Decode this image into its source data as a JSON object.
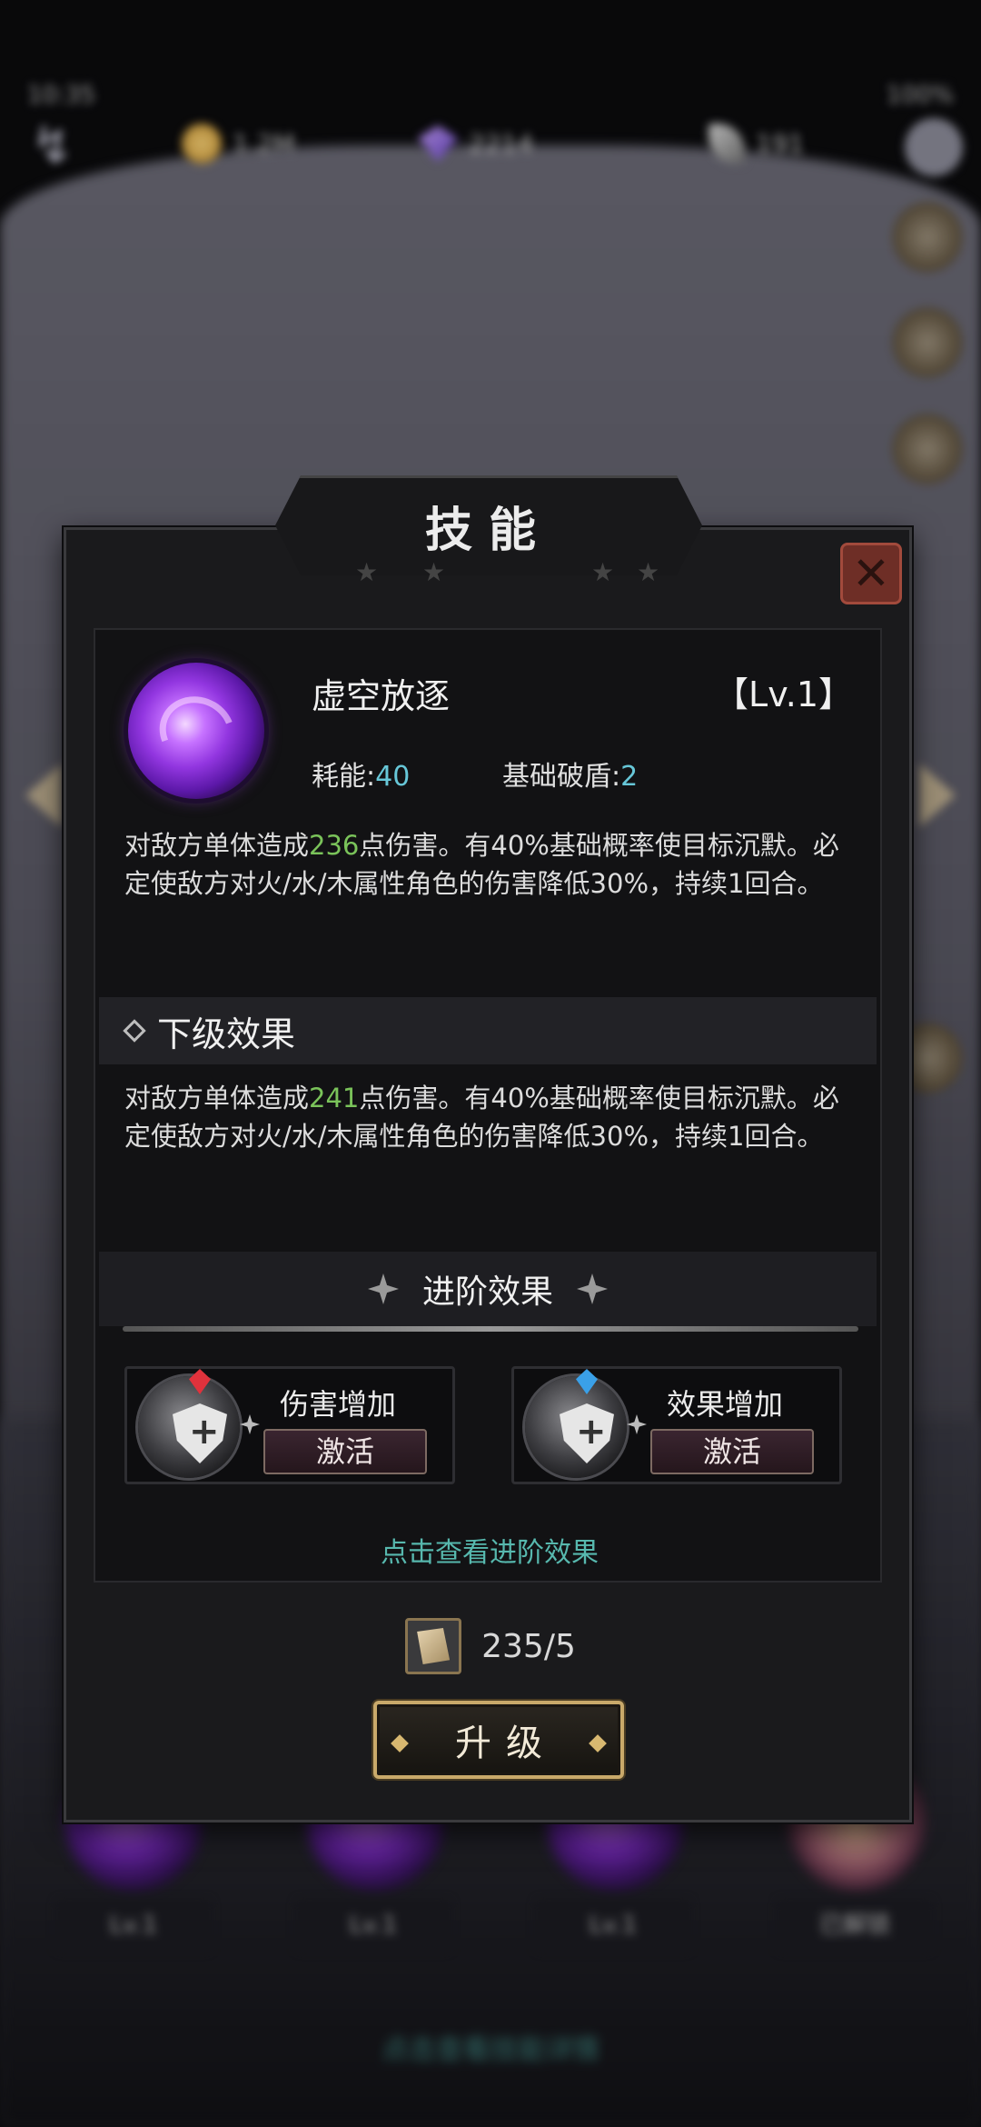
{
  "status_bar": {
    "time": "10:35",
    "battery": "100%"
  },
  "resources": [
    {
      "icon": "coin-icon",
      "value": "1.2M"
    },
    {
      "icon": "gem-icon",
      "value": "2214"
    },
    {
      "icon": "feather-icon",
      "value": "191"
    }
  ],
  "background": {
    "levels": [
      "Lv.1",
      "Lv.1",
      "Lv.1",
      "已解锁"
    ],
    "hint": "点击查看技能详情"
  },
  "dialog": {
    "title": "技能",
    "skill": {
      "name": "虚空放逐",
      "level": "【Lv.1】",
      "cost_label": "耗能:",
      "cost_value": "40",
      "break_label": "基础破盾:",
      "break_value": "2",
      "desc_prefix": "对敌方单体造成",
      "desc_damage": "236",
      "desc_suffix": "点伤害。有40%基础概率使目标沉默。必定使敌方对火/水/木属性角色的伤害降低30%，持续1回合。"
    },
    "next_level": {
      "title": "下级效果",
      "desc_prefix": "对敌方单体造成",
      "desc_damage": "241",
      "desc_suffix": "点伤害。有40%基础概率使目标沉默。必定使敌方对火/水/木属性角色的伤害降低30%，持续1回合。"
    },
    "advanced": {
      "title": "进阶效果",
      "perks": [
        {
          "name": "伤害增加",
          "button": "激活",
          "gem_color": "#e0323c"
        },
        {
          "name": "效果增加",
          "button": "激活",
          "gem_color": "#3aa0e8"
        }
      ],
      "link": "点击查看进阶效果"
    },
    "cost": {
      "amount": "235/5"
    },
    "upgrade_label": "升级"
  },
  "colors": {
    "accent_teal": "#57b8ae",
    "highlight_green": "#7ac35a",
    "stat_cyan": "#67c7d8",
    "gold": "#c9a96a"
  }
}
